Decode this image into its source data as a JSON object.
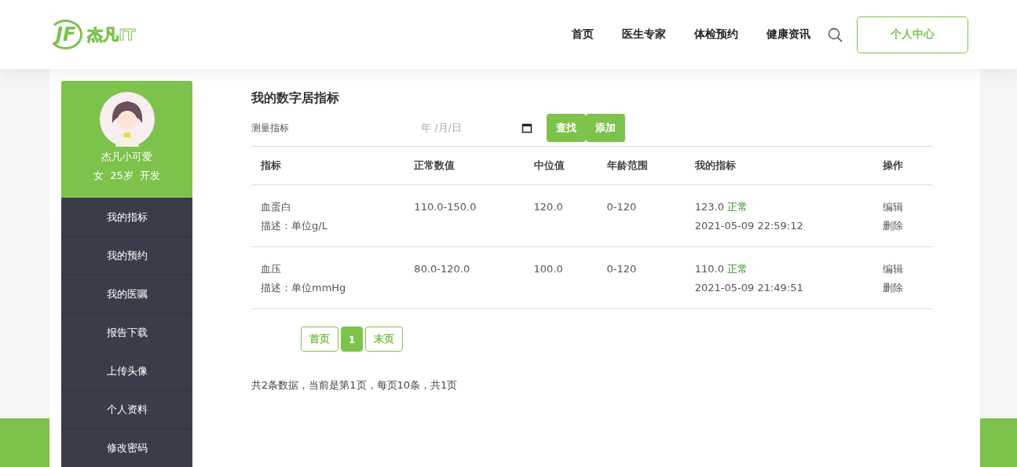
{
  "header": {
    "logo": {
      "mark": "JF",
      "text": "杰凡IT"
    },
    "nav": [
      {
        "label": "首页"
      },
      {
        "label": "医生专家"
      },
      {
        "label": "体检预约"
      },
      {
        "label": "健康资讯"
      }
    ],
    "account_button": "个人中心"
  },
  "sidebar": {
    "profile": {
      "name": "杰凡小可爱",
      "details": "女  25岁  开发"
    },
    "items": [
      {
        "label": "我的指标"
      },
      {
        "label": "我的预约"
      },
      {
        "label": "我的医嘱"
      },
      {
        "label": "报告下载"
      },
      {
        "label": "上传头像"
      },
      {
        "label": "个人资料"
      },
      {
        "label": "修改密码"
      }
    ]
  },
  "main": {
    "title": "我的数字居指标",
    "filter": {
      "label": "测量指标",
      "date": {
        "placeholder": "年 /月/日"
      },
      "buttons": [
        "查找",
        "添加"
      ]
    },
    "table": {
      "columns": [
        "指标",
        "正常数值",
        "中位值",
        "年龄范围",
        "我的指标",
        "操作"
      ],
      "rows": [
        {
          "name": "血蛋白",
          "description": "描述：单位g/L",
          "normal": "110.0-150.0",
          "median": "120.0",
          "age": "0-120",
          "value": "123.0",
          "status": "正常",
          "time": "2021-05-09 22:59:12",
          "actions": [
            "编辑",
            "删除"
          ]
        },
        {
          "name": "血压",
          "description": "描述：单位mmHg",
          "normal": "80.0-120.0",
          "median": "100.0",
          "age": "0-120",
          "value": "110.0",
          "status": "正常",
          "time": "2021-05-09 21:49:51",
          "actions": [
            "编辑",
            "删除"
          ]
        }
      ]
    },
    "pagination": {
      "pages": [
        {
          "label": "首页",
          "selected": false
        },
        {
          "label": "1",
          "selected": true
        },
        {
          "label": "末页",
          "selected": false
        }
      ]
    },
    "summary": "共2条数据，当前是第1页，每页10条，共1页"
  }
}
